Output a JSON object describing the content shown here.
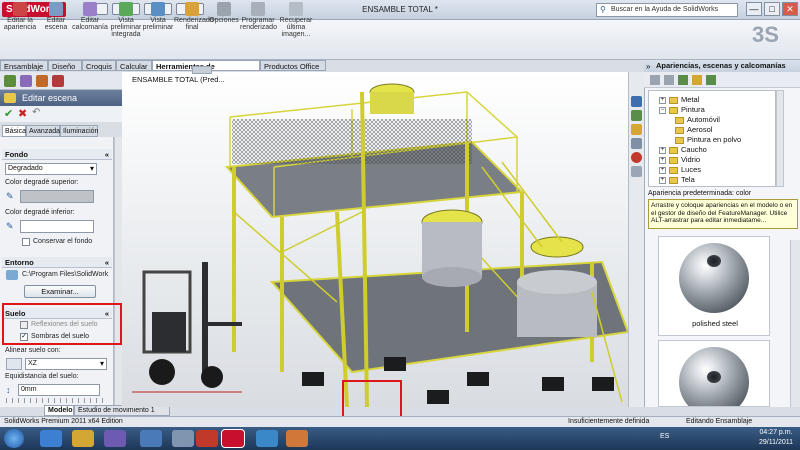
{
  "app": {
    "logo_text": "SolidWorks",
    "window_title": "ENSAMBLE TOTAL *",
    "search_placeholder": "Buscar en la Ayuda de SolidWorks",
    "window_buttons": [
      "—",
      "□",
      "✕"
    ]
  },
  "ribbon": {
    "buttons": [
      {
        "label": "Editar la apariencia",
        "icon": "appearance-icon"
      },
      {
        "label": "Editar escena",
        "icon": "scene-icon"
      },
      {
        "label": "Editar calcomanía",
        "icon": "decal-icon"
      },
      {
        "label": "Vista preliminar integrada",
        "icon": "preview-integrated-icon"
      },
      {
        "label": "Vista preliminar",
        "icon": "preview-icon"
      },
      {
        "label": "Renderizado final",
        "icon": "render-icon"
      },
      {
        "label": "Opciones",
        "icon": "options-icon"
      },
      {
        "label": "Programar renderizado",
        "icon": "schedule-icon"
      },
      {
        "label": "Recuperar última imagen...",
        "icon": "recall-icon"
      }
    ]
  },
  "command_tabs": [
    "Ensamblaje",
    "Diseño",
    "Croquis",
    "Calcular",
    "Herramientas de renderizado",
    "Productos Office"
  ],
  "left_panel": {
    "title": "Editar escena",
    "subtabs": [
      "Básica",
      "Avanzada",
      "Iluminación"
    ],
    "fondo": {
      "header": "Fondo",
      "type_value": "Degradado",
      "color_sup_label": "Color degradé superior:",
      "color_inf_label": "Color degradé inferior:",
      "keep_bg_label": "Conservar el fondo"
    },
    "entorno": {
      "header": "Entorno",
      "path": "C:\\Program Files\\SolidWork",
      "browse_button": "Examinar..."
    },
    "suelo": {
      "header": "Suelo",
      "reflections_label": "Reflexiones del suelo",
      "reflections_checked": false,
      "shadows_label": "Sombras del suelo",
      "shadows_checked": true,
      "align_label": "Alinear suelo con:",
      "align_value": "XZ",
      "offset_label": "Equidistancia del suelo:",
      "offset_value": "0mm"
    }
  },
  "bottom_tabs": [
    "Modelo",
    "Estudio de movimiento 1"
  ],
  "viewport": {
    "title": "ENSAMBLE TOTAL  (Pred..."
  },
  "right_panel": {
    "title": "Apariencias, escenas y calcomanías",
    "tree": [
      {
        "label": "Metal",
        "indent": 1
      },
      {
        "label": "Pintura",
        "indent": 1
      },
      {
        "label": "Automóvil",
        "indent": 2
      },
      {
        "label": "Aerosol",
        "indent": 2
      },
      {
        "label": "Pintura en polvo",
        "indent": 2
      },
      {
        "label": "Caucho",
        "indent": 1
      },
      {
        "label": "Vidrio",
        "indent": 1
      },
      {
        "label": "Luces",
        "indent": 1
      },
      {
        "label": "Tela",
        "indent": 1
      }
    ],
    "default_appearance": "Apariencia predeterminada: color",
    "tooltip": "Arrastre y coloque apariencias en el modelo o en el gestor de diseño del FeatureManager. Utilice ALT-arrastrar para editar inmediatame...",
    "swatches": [
      "polished steel",
      ""
    ]
  },
  "status_bar": {
    "left": "SolidWorks Premium 2011 x64 Edition",
    "middle": "Insuficientemente definida",
    "right": "Editando Ensamblaje"
  },
  "taskbar": {
    "lang": "ES",
    "time": "04:27 p.m.",
    "date": "29/11/2011"
  },
  "colors": {
    "accent": "#c8102e",
    "highlight": "#e0151b",
    "structure": "#e3e23c"
  }
}
